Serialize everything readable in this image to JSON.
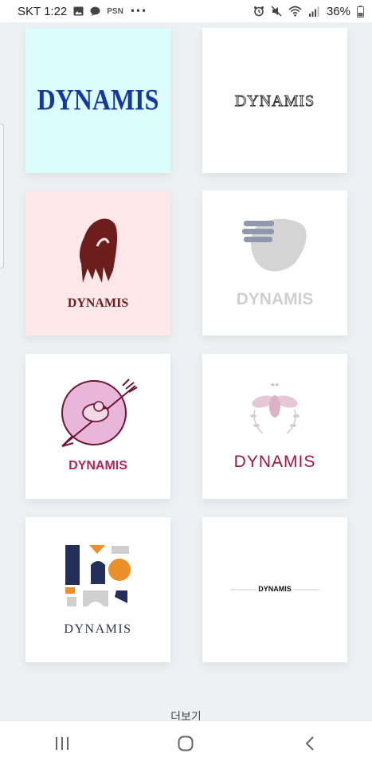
{
  "status_bar": {
    "carrier_time": "SKT 1:22",
    "extra_label": "PSN",
    "more": "•••",
    "battery": "36%",
    "icons": [
      "image-icon",
      "chat-bubble-icon",
      "alarm-icon",
      "mute-icon",
      "wifi-icon",
      "signal-icon",
      "battery-icon"
    ]
  },
  "logos": [
    {
      "name": "DYNAMIS",
      "style": "blackletter-blue",
      "background": "#dcfdfd",
      "color": "#1537a3"
    },
    {
      "name": "DYNAMIS",
      "style": "outlined-serif",
      "background": "#ffffff",
      "color": "#2a2a2a"
    },
    {
      "name": "DYNAMIS",
      "style": "brush-stroke",
      "background": "#fde7e7",
      "color": "#6e1d1d"
    },
    {
      "name": "DYNAMIS",
      "style": "grunge-blob",
      "background": "#ffffff",
      "color": "#cfcfcf"
    },
    {
      "name": "DYNAMIS",
      "style": "bird-arrow-emblem",
      "background": "#ffffff",
      "color": "#b0265a"
    },
    {
      "name": "DYNAMIS",
      "style": "bee-wreath",
      "background": "#ffffff",
      "color": "#a3153f"
    },
    {
      "name": "DYNAMIS",
      "style": "geometric-shapes",
      "background": "#ffffff",
      "color": "#2e3350"
    },
    {
      "name": "DYNAMIS",
      "style": "minimal-line",
      "background": "#ffffff",
      "color": "#111111"
    }
  ],
  "more_label": "더보기",
  "nav": {
    "icons": [
      "recent-apps-icon",
      "home-icon",
      "back-icon"
    ]
  }
}
